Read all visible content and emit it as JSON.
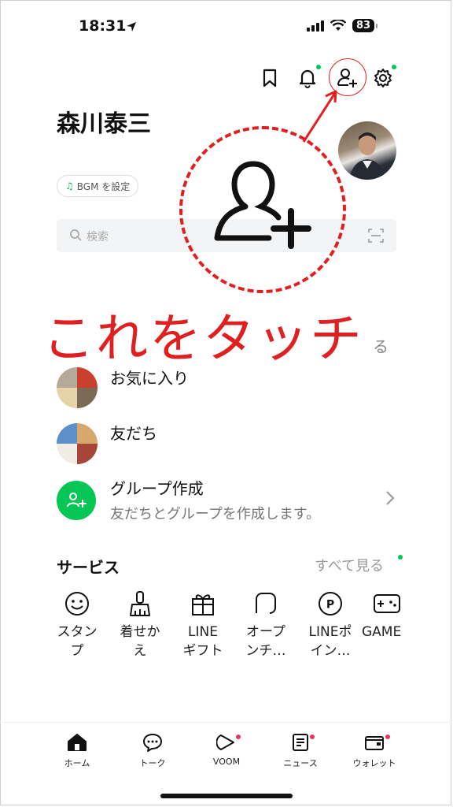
{
  "status": {
    "time": "18:31",
    "battery": "83"
  },
  "profile": {
    "name": "森川泰三",
    "bgm_label": "BGM を設定"
  },
  "search": {
    "placeholder": "検索"
  },
  "annotation": {
    "text": "これをタッチ"
  },
  "section_peek": "る",
  "rows": {
    "favorites": {
      "label": "お気に入り"
    },
    "friends": {
      "label": "友だち"
    },
    "group": {
      "label": "グループ作成",
      "sub": "友だちとグループを作成します。"
    }
  },
  "services": {
    "title": "サービス",
    "see_all": "すべて見る",
    "items": [
      {
        "line1": "スタン",
        "line2": "プ",
        "icon": "smile-icon"
      },
      {
        "line1": "着せか",
        "line2": "え",
        "icon": "brush-icon"
      },
      {
        "line1": "LINE",
        "line2": "ギフト",
        "icon": "gift-icon"
      },
      {
        "line1": "オープ",
        "line2": "ンチ…",
        "icon": "openchat-icon"
      },
      {
        "line1": "LINEポ",
        "line2": "イン…",
        "icon": "points-icon"
      },
      {
        "line1": "GAME",
        "line2": "",
        "icon": "game-icon"
      }
    ]
  },
  "tabs": [
    {
      "label": "ホーム"
    },
    {
      "label": "トーク"
    },
    {
      "label": "VOOM"
    },
    {
      "label": "ニュース"
    },
    {
      "label": "ウォレット"
    }
  ],
  "colors": {
    "accent": "#06c755",
    "annotation": "#e02020"
  }
}
